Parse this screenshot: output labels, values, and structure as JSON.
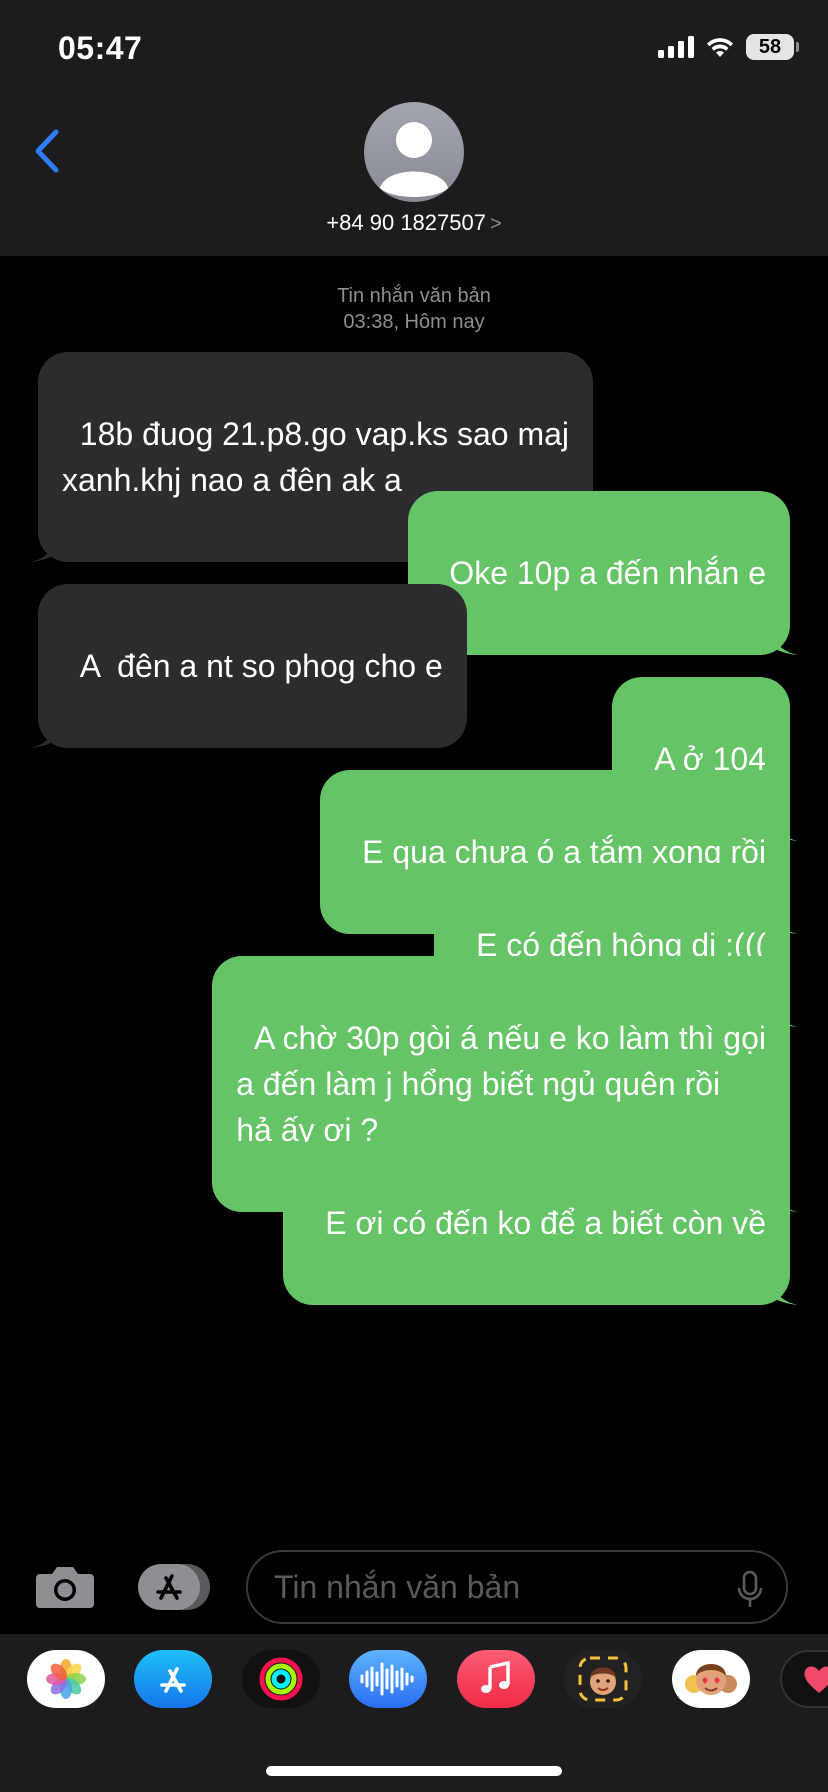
{
  "status_bar": {
    "time": "05:47",
    "battery": "58"
  },
  "contact": {
    "phone": "+84 90 1827507",
    "chevron": ">"
  },
  "thread": {
    "meta_type": "Tin nhắn văn bản",
    "meta_time": "03:38, Hôm nay"
  },
  "messages": [
    {
      "dir": "in",
      "text": "18b đuog 21.p8.go vap.ks sao maj\nxanh.khj nao a đên ak a"
    },
    {
      "dir": "out",
      "text": "Oke 10p a đến nhắn e"
    },
    {
      "dir": "in",
      "text": "A  đên a nt so phog cho e"
    },
    {
      "dir": "out",
      "text": "A ở 104"
    },
    {
      "dir": "out",
      "text": "E qua chưa ó a tắm xong rồi"
    },
    {
      "dir": "out",
      "text": "E có đến hông dị :((("
    },
    {
      "dir": "out",
      "text": "A chờ 30p gòi á nếu e ko làm thì gọi\na đến làm j hổng biết ngủ quên rồi\nhả ấy ơi ?"
    },
    {
      "dir": "out",
      "text": "E ơi có đến ko để a biết còn về"
    }
  ],
  "input": {
    "placeholder": "Tin nhắn văn bản"
  },
  "app_drawer": [
    "photos-icon",
    "app-store-icon",
    "activity-icon",
    "audio-message-icon",
    "music-icon",
    "memoji-icon",
    "memoji-stickers-icon",
    "digital-touch-icon"
  ],
  "colors": {
    "outgoing": "#65c466",
    "incoming": "#2c2c2e",
    "accent": "#2f7cf6",
    "header": "#1c1c1e"
  }
}
